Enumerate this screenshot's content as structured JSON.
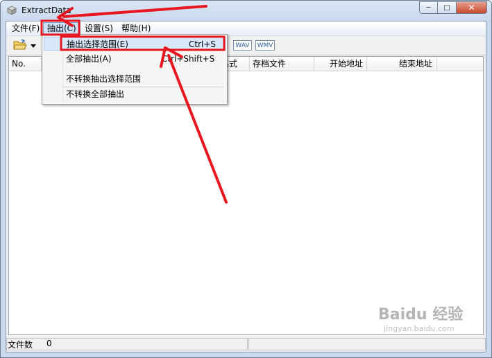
{
  "window": {
    "title": "ExtractData"
  },
  "caption": {
    "minimize": "─",
    "maximize": "□",
    "close": "✕"
  },
  "menubar": {
    "items": [
      "文件(F)",
      "抽出(C)",
      "设置(S)",
      "帮助(H)"
    ]
  },
  "toolbar": {
    "wav_label": "WAV",
    "wmv_label": "WMV"
  },
  "list": {
    "columns": [
      "No.",
      "",
      "",
      "格式",
      "存档文件",
      "开始地址",
      "结束地址"
    ]
  },
  "dropdown": {
    "items": [
      {
        "label": "抽出选择范围(E)",
        "accel": "Ctrl+S"
      },
      {
        "label": "全部抽出(A)",
        "accel": "Ctrl+Shift+S"
      },
      {
        "label": "不转换抽出选择范围",
        "accel": ""
      },
      {
        "label": "不转换全部抽出",
        "accel": ""
      }
    ]
  },
  "statusbar": {
    "label": "文件数",
    "count": "0"
  },
  "watermark": {
    "logo": "Baidu 经验",
    "url": "jingyan.baidu.com"
  },
  "colors": {
    "annotation": "#e8171f",
    "highlight": "#d9e8f8"
  },
  "icons": [
    "app-icon",
    "open-folder-icon",
    "dropdown-arrow-icon",
    "minimize-icon",
    "maximize-icon",
    "close-icon"
  ]
}
